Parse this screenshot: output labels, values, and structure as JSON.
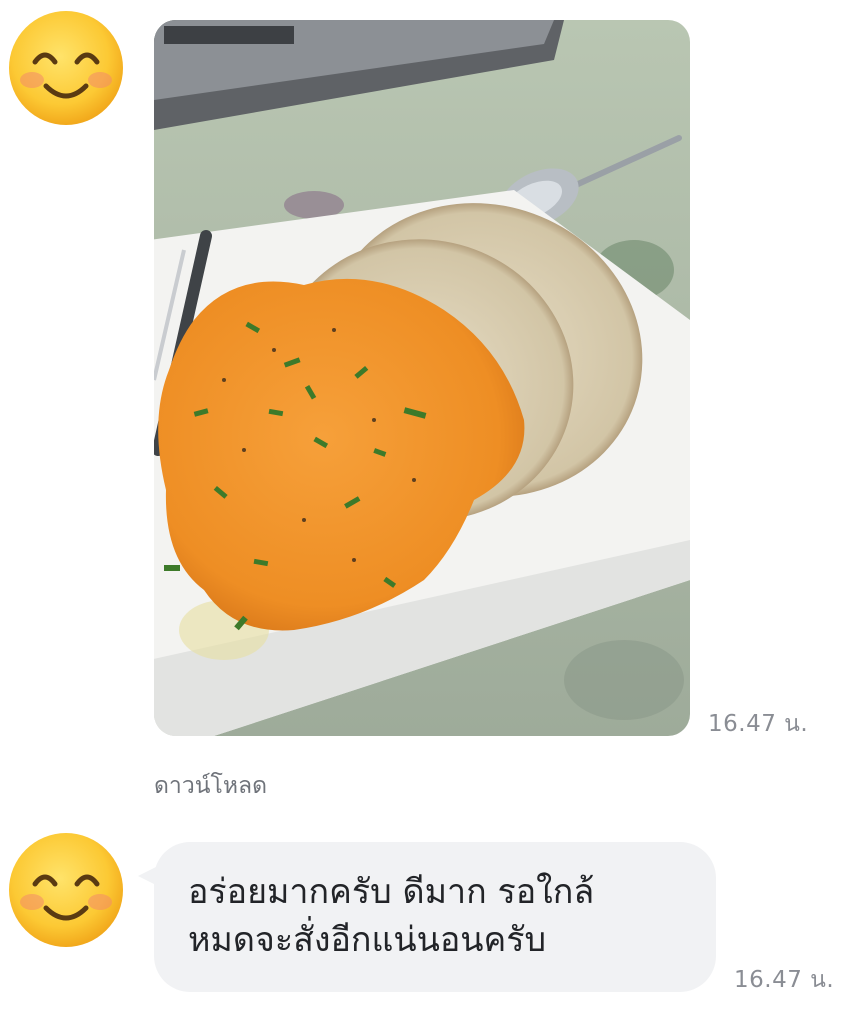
{
  "messages": [
    {
      "type": "image",
      "avatar_icon": "smiling-face-emoji-icon",
      "image_subject": "scrambled eggs with chives on toasted sourdough bread on a white plate",
      "time": "16.47 น.",
      "download_label": "ดาวน์โหลด"
    },
    {
      "type": "text",
      "avatar_icon": "smiling-face-emoji-icon",
      "lines": [
        "อร่อยมากครับ ดีมาก รอใกล้",
        "หมดจะสั่งอีกแน่นอนครับ"
      ],
      "time": "16.47 น."
    }
  ],
  "colors": {
    "bubble": "#f1f2f4",
    "time_text": "#8a8d94",
    "message_text": "#222428"
  }
}
